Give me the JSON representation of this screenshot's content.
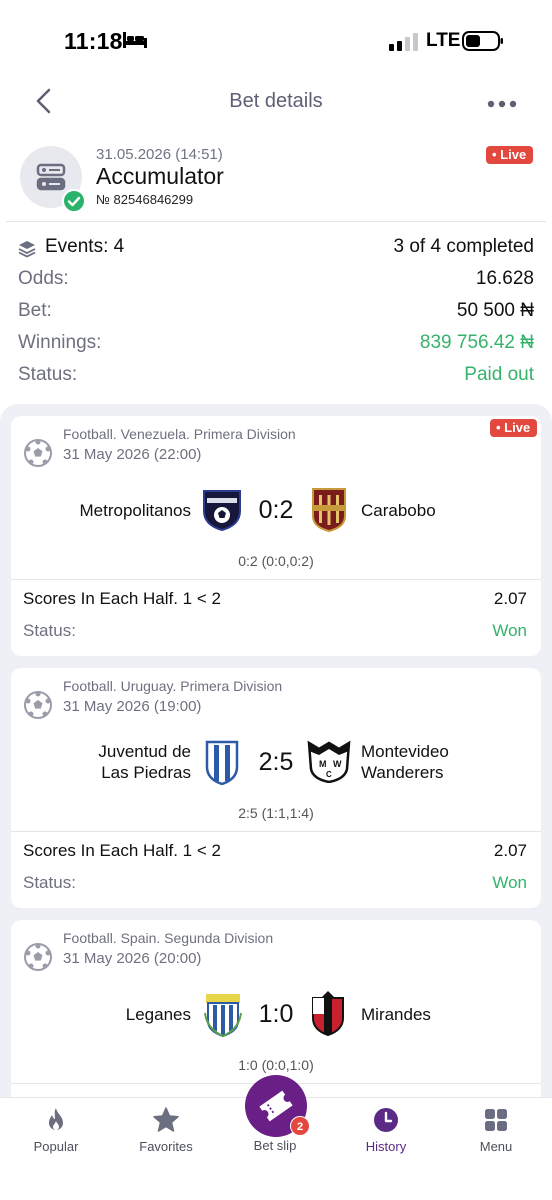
{
  "status_bar": {
    "time": "11:18",
    "network": "LTE"
  },
  "header": {
    "title": "Bet details"
  },
  "bet": {
    "date": "31.05.2026 (14:51)",
    "type": "Accumulator",
    "number": "№ 82546846299",
    "live_label": "• Live",
    "events_label": "Events: 4",
    "events_completed": "3 of 4 completed",
    "odds_label": "Odds:",
    "odds_value": "16.628",
    "bet_label": "Bet:",
    "bet_value": "50 500 ₦",
    "winnings_label": "Winnings:",
    "winnings_value": "839 756.42 ₦",
    "status_label": "Status:",
    "status_value": "Paid out"
  },
  "events": [
    {
      "league": "Football. Venezuela. Primera Division",
      "date": "31 May 2026 (22:00)",
      "live_label": "• Live",
      "home": "Metropolitanos",
      "away": "Carabobo",
      "score": "0:2",
      "score_detail": "0:2 (0:0,0:2)",
      "market": "Scores In Each Half. 1 < 2",
      "odds": "2.07",
      "status_label": "Status:",
      "status": "Won"
    },
    {
      "league": "Football. Uruguay. Primera Division",
      "date": "31 May 2026 (19:00)",
      "home_line1": "Juventud de",
      "home_line2": "Las Piedras",
      "away_line1": "Montevideo",
      "away_line2": "Wanderers",
      "score": "2:5",
      "score_detail": "2:5 (1:1,1:4)",
      "market": "Scores In Each Half. 1 < 2",
      "odds": "2.07",
      "status_label": "Status:",
      "status": "Won"
    },
    {
      "league": "Football. Spain. Segunda Division",
      "date": "31 May 2026 (20:00)",
      "home": "Leganes",
      "away": "Mirandes",
      "score": "1:0",
      "score_detail": "1:0 (0:0,1:0)"
    }
  ],
  "tabs": [
    {
      "label": "Popular",
      "icon": "flame-icon"
    },
    {
      "label": "Favorites",
      "icon": "star-icon"
    },
    {
      "label": "Bet slip",
      "icon": "ticket-icon",
      "badge": "2"
    },
    {
      "label": "History",
      "icon": "clock-icon",
      "active": true
    },
    {
      "label": "Menu",
      "icon": "grid-icon"
    }
  ],
  "colors": {
    "accent": "#6a1f87",
    "live": "#e2483d",
    "won": "#36b26b"
  }
}
